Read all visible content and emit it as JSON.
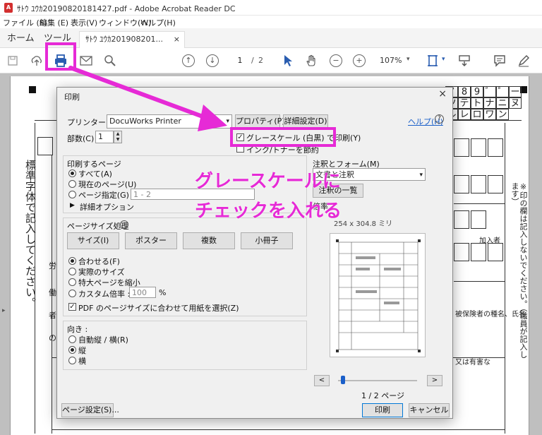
{
  "window": {
    "title": "ｻﾄｳ ﾕｳｶ20190820181427.pdf - Adobe Acrobat Reader DC"
  },
  "menu": [
    "ファイル (F)",
    "編集 (E)",
    "表示(V)",
    "ウィンドウ(W)",
    "ヘルプ(H)"
  ],
  "tabs": {
    "home": "ホーム",
    "tools": "ツール",
    "document": "ｻﾄｳ ﾕｳｶ201908201...",
    "close": "×"
  },
  "toolbar": {
    "page_current": "1",
    "page_sep": "/",
    "page_total": "2",
    "zoom": "107%"
  },
  "background_form": {
    "right_header": [
      "7",
      "8",
      "9",
      "゛",
      "゜",
      "ー",
      "ツ",
      "テ",
      "ト",
      "ナ",
      "ニ",
      "ヌ",
      "ル",
      "レ",
      "ロ",
      "ワ",
      "ン"
    ],
    "left_text": "標準字体で記入してください。",
    "right_note": "※印の欄は記入しないでください。（職員が記入します）",
    "snippets": [
      "労",
      "働",
      "者",
      "の",
      "被保険者の種名、氏名",
      "加入者",
      "又は有害な"
    ]
  },
  "dialog": {
    "title": "印刷",
    "close": "×",
    "printer_label": "プリンター(N) :",
    "printer_value": "DocuWorks Printer",
    "properties_btn": "プロパティ(P)",
    "advanced_btn": "詳細設定(D)",
    "help_link": "ヘルプ(H)",
    "copies_label": "部数(C) :",
    "copies_value": "1",
    "grayscale_label": "グレースケール (白黒) で印刷(Y)",
    "grayscale_checked": true,
    "save_ink_label": "インク/トナーを節約",
    "pages_group": "印刷するページ",
    "pages_all": "すべて(A)",
    "pages_current": "現在のページ(U)",
    "pages_range": "ページ指定(G)",
    "pages_range_value": "1 - 2",
    "more_options": "詳細オプション",
    "sizing_group": "ページサイズ処理",
    "size_btn": "サイズ(I)",
    "poster_btn": "ポスター",
    "multiple_btn": "複数",
    "booklet_btn": "小冊子",
    "fit": "合わせる(F)",
    "actual": "実際のサイズ",
    "shrink": "特大ページを縮小",
    "custom_scale": "カスタム倍率 :",
    "custom_scale_value": "100",
    "percent": "%",
    "pdf_paper": "PDF のページサイズに合わせて用紙を選択(Z)",
    "orientation_group": "向き :",
    "auto": "自動縦 / 横(R)",
    "portrait": "縦",
    "landscape": "横",
    "comments_group": "注釈とフォーム(M)",
    "comments_value": "文書と注釈",
    "summary_btn": "注釈の一覧",
    "scale_label": "倍率",
    "paper_size": "254 x 304.8 ミリ",
    "page_indicator": "1 / 2 ページ",
    "prev": "<",
    "next": ">",
    "page_setup_btn": "ページ設定(S)...",
    "print_btn": "印刷",
    "cancel_btn": "キャンセル"
  },
  "annotation": {
    "line1": "グレースケールに",
    "line2": "チェックを入れる",
    "color": "#e62ad6"
  }
}
